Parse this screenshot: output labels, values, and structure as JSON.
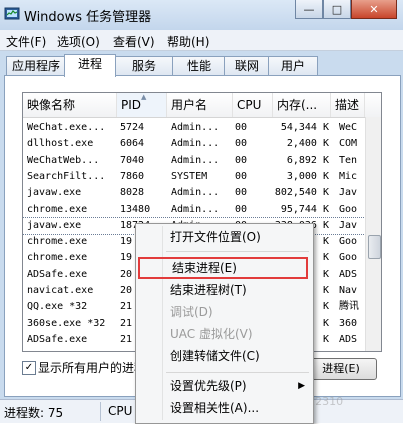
{
  "window": {
    "title": "Windows 任务管理器",
    "controls": {
      "minimize": "—",
      "maximize": "□",
      "close": "✕"
    }
  },
  "menubar": {
    "items": [
      "文件(F)",
      "选项(O)",
      "查看(V)",
      "帮助(H)"
    ]
  },
  "tabs": {
    "items": [
      "应用程序",
      "进程",
      "服务",
      "性能",
      "联网",
      "用户"
    ],
    "active": "进程"
  },
  "process_list": {
    "columns": [
      "映像名称",
      "PID",
      "用户名",
      "CPU",
      "内存(...",
      "描述"
    ],
    "sorted_column": "PID",
    "rows": [
      {
        "name": "WeChat.exe...",
        "pid": "5724",
        "user": "Admin...",
        "cpu": "00",
        "mem": "54,344 K",
        "desc": "WeC"
      },
      {
        "name": "dllhost.exe",
        "pid": "6064",
        "user": "Admin...",
        "cpu": "00",
        "mem": "2,400 K",
        "desc": "COM"
      },
      {
        "name": "WeChatWeb...",
        "pid": "7040",
        "user": "Admin...",
        "cpu": "00",
        "mem": "6,892 K",
        "desc": "Ten"
      },
      {
        "name": "SearchFilt...",
        "pid": "7860",
        "user": "SYSTEM",
        "cpu": "00",
        "mem": "3,000 K",
        "desc": "Mic"
      },
      {
        "name": "javaw.exe",
        "pid": "8028",
        "user": "Admin...",
        "cpu": "00",
        "mem": "802,540 K",
        "desc": "Jav"
      },
      {
        "name": "chrome.exe",
        "pid": "13480",
        "user": "Admin...",
        "cpu": "00",
        "mem": "95,744 K",
        "desc": "Goo"
      },
      {
        "name": "javaw.exe",
        "pid": "18724",
        "user": "Admin...",
        "cpu": "00",
        "mem": "338,036 K",
        "desc": "Jav"
      },
      {
        "name": "chrome.exe",
        "pid": "19",
        "user": "",
        "cpu": "",
        "mem": "K",
        "desc": "Goo"
      },
      {
        "name": "chrome.exe",
        "pid": "19",
        "user": "",
        "cpu": "",
        "mem": "K",
        "desc": "Goo"
      },
      {
        "name": "ADSafe.exe",
        "pid": "20",
        "user": "",
        "cpu": "",
        "mem": "K",
        "desc": "ADS"
      },
      {
        "name": "navicat.exe",
        "pid": "20",
        "user": "",
        "cpu": "",
        "mem": "K",
        "desc": "Nav"
      },
      {
        "name": "QQ.exe *32",
        "pid": "21",
        "user": "",
        "cpu": "",
        "mem": "K",
        "desc": "腾讯"
      },
      {
        "name": "360se.exe *32",
        "pid": "21",
        "user": "",
        "cpu": "",
        "mem": "K",
        "desc": "360"
      },
      {
        "name": "ADSafe.exe",
        "pid": "21",
        "user": "",
        "cpu": "",
        "mem": "K",
        "desc": "ADS"
      }
    ]
  },
  "footer": {
    "show_all_label": "显示所有用户的进程(S)",
    "show_all_checked": "✓",
    "end_process_label": "进程(E)"
  },
  "statusbar": {
    "process_count": "进程数: 75",
    "cpu_label": "CPU"
  },
  "context_menu": {
    "items": [
      {
        "label": "打开文件位置(O)",
        "disabled": false
      },
      {
        "label": "结束进程(E)",
        "disabled": false,
        "highlighted": true
      },
      {
        "label": "结束进程树(T)",
        "disabled": false
      },
      {
        "label": "调试(D)",
        "disabled": true
      },
      {
        "label": "UAC 虚拟化(V)",
        "disabled": true
      },
      {
        "label": "创建转储文件(C)",
        "disabled": false
      },
      {
        "label": "设置优先级(P)",
        "disabled": false,
        "submenu": true
      },
      {
        "label": "设置相关性(A)...",
        "disabled": false
      }
    ],
    "submenu_arrow": "▶"
  },
  "watermark": "https://blog.csdn.net/qq_32312310"
}
